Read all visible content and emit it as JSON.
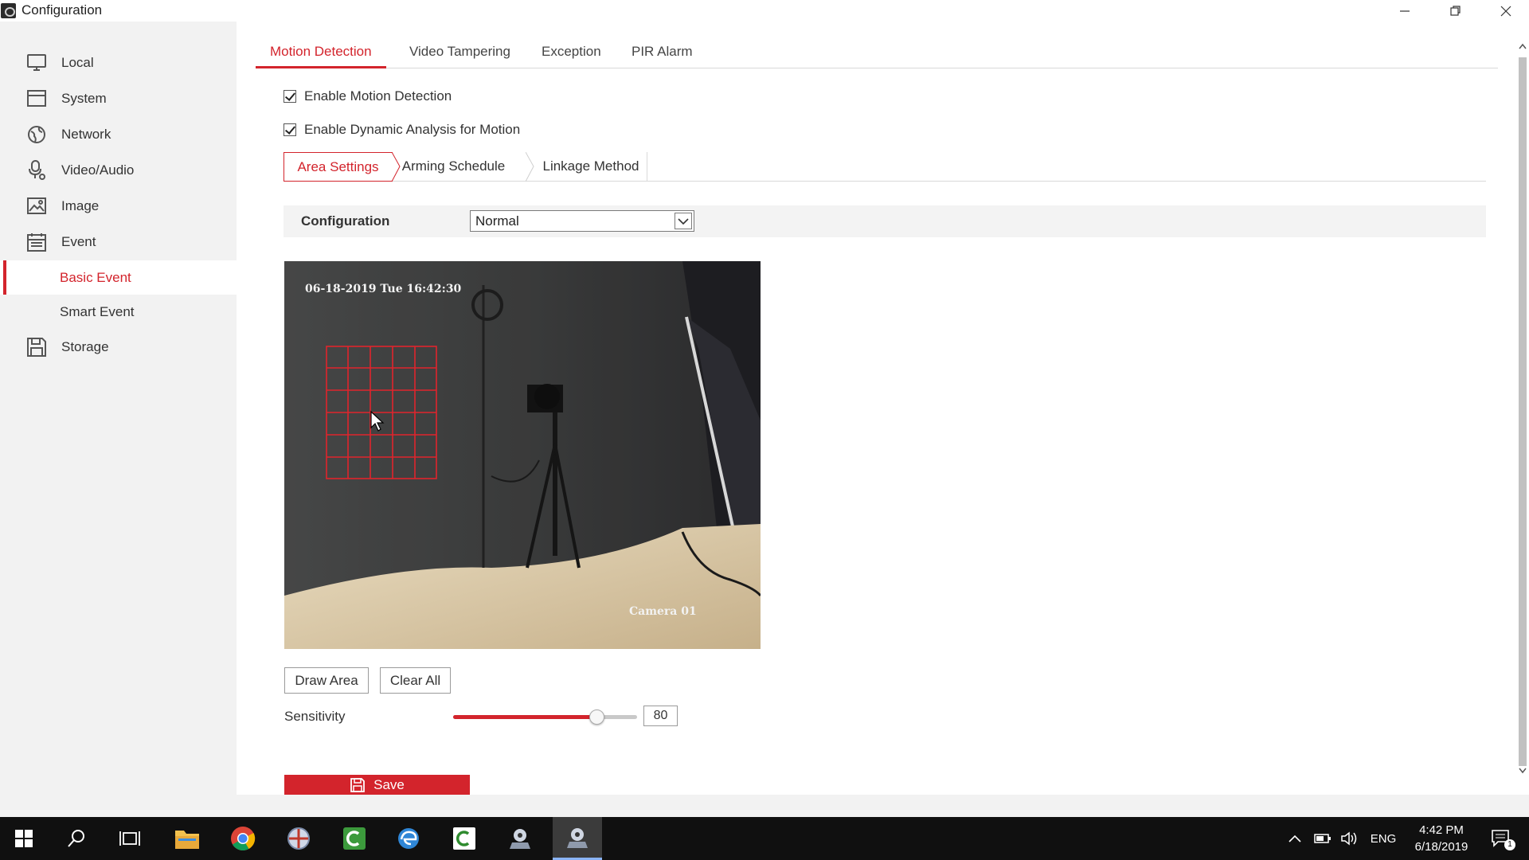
{
  "window": {
    "title": "Configuration"
  },
  "sidebar": {
    "items": [
      {
        "label": "Local",
        "icon": "monitor-icon"
      },
      {
        "label": "System",
        "icon": "system-icon"
      },
      {
        "label": "Network",
        "icon": "globe-icon"
      },
      {
        "label": "Video/Audio",
        "icon": "microphone-icon"
      },
      {
        "label": "Image",
        "icon": "image-icon"
      },
      {
        "label": "Event",
        "icon": "calendar-icon"
      },
      {
        "label": "Basic Event",
        "active": true
      },
      {
        "label": "Smart Event"
      },
      {
        "label": "Storage",
        "icon": "storage-icon"
      }
    ]
  },
  "tabs": {
    "motion_detection": "Motion Detection",
    "video_tampering": "Video Tampering",
    "exception": "Exception",
    "pir_alarm": "PIR Alarm"
  },
  "options": {
    "enable_motion_detection": {
      "label": "Enable Motion Detection",
      "checked": true
    },
    "enable_dynamic_analysis": {
      "label": "Enable Dynamic Analysis for Motion",
      "checked": true
    }
  },
  "subtabs": {
    "area_settings": "Area Settings",
    "arming_schedule": "Arming Schedule",
    "linkage_method": "Linkage Method"
  },
  "configuration": {
    "label": "Configuration",
    "value": "Normal"
  },
  "video": {
    "timestamp": "06-18-2019 Tue 16:42:30",
    "camera_name": "Camera 01"
  },
  "buttons": {
    "draw_area": "Draw Area",
    "clear_all": "Clear All",
    "save": "Save"
  },
  "sensitivity": {
    "label": "Sensitivity",
    "value": "80",
    "slider_fraction": 0.78
  },
  "taskbar": {
    "language": "ENG",
    "time": "4:42 PM",
    "date": "6/18/2019",
    "notification_count": "1"
  },
  "colors": {
    "accent": "#d3242c",
    "sidebar_bg": "#f2f2f2",
    "taskbar_bg": "#101010"
  }
}
